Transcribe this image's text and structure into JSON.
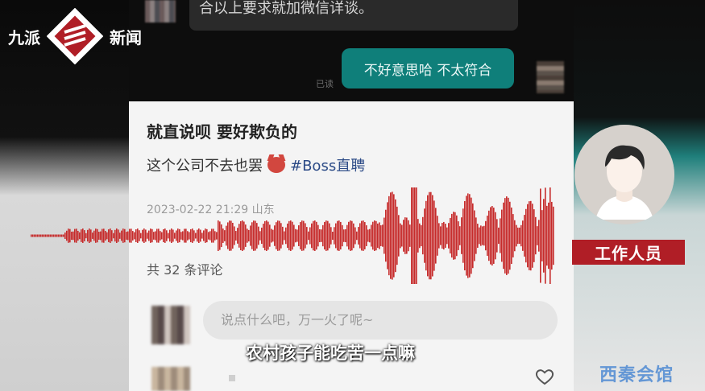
{
  "logo": {
    "left_text": "九派",
    "right_text": "新闻"
  },
  "chat": {
    "incoming_message": "合以上要求就加微信详谈。",
    "outgoing_message": "不好意思哈 不太符合",
    "read_status": "已读"
  },
  "post": {
    "title": "就直说呗 要好欺负的",
    "body_text": "这个公司不去也罢",
    "hashtag": "#Boss直聘",
    "meta": "2023-02-22 21:29 山东",
    "comment_count_text": "共 32 条评论",
    "comment_placeholder": "说点什么吧，万一火了呢~"
  },
  "staff": {
    "label": "工作人员"
  },
  "subtitle": "农村孩子能吃苦一点嘛",
  "watermark": "西秦会馆",
  "icons": [
    "emoji-devil-icon",
    "heart-icon",
    "person-avatar-icon",
    "logo-mark-icon"
  ],
  "colors": {
    "accent_teal": "#0f7f7a",
    "label_red": "#b01e26",
    "wave_red": "#c62a2a",
    "hashtag_blue": "#2b4a86"
  }
}
